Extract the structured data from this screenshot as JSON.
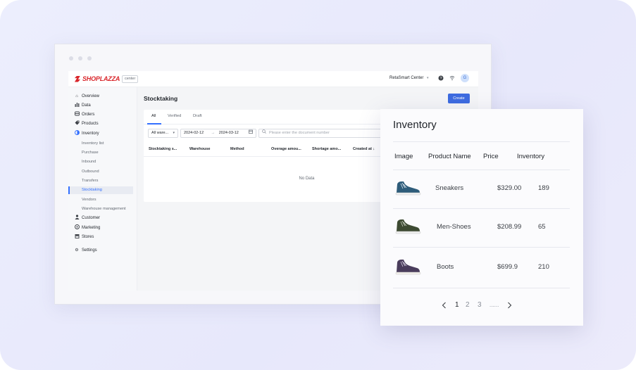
{
  "app": {
    "logo_text": "SHOPLAZZA",
    "logo_tag": "center",
    "store_selector": "RetaSmart Center",
    "avatar_initial": "G"
  },
  "sidebar": {
    "nav": [
      {
        "label": "Overview",
        "icon": "home-icon"
      },
      {
        "label": "Data",
        "icon": "bar-chart-icon"
      },
      {
        "label": "Orders",
        "icon": "orders-icon"
      },
      {
        "label": "Products",
        "icon": "tag-icon"
      },
      {
        "label": "Inventory",
        "icon": "inventory-icon"
      }
    ],
    "inventory_sub": [
      {
        "label": "Inventory list"
      },
      {
        "label": "Purchase"
      },
      {
        "label": "Inbound"
      },
      {
        "label": "Outbound"
      },
      {
        "label": "Transfers"
      },
      {
        "label": "Stocktaking",
        "active": true
      },
      {
        "label": "Vendors"
      },
      {
        "label": "Warehouse management"
      }
    ],
    "nav_after": [
      {
        "label": "Customer",
        "icon": "user-icon"
      },
      {
        "label": "Marketing",
        "icon": "marketing-icon"
      },
      {
        "label": "Stores",
        "icon": "store-icon"
      },
      {
        "label": "Settings",
        "icon": "gear-icon"
      }
    ]
  },
  "main": {
    "title": "Stocktaking",
    "create_label": "Create",
    "tabs": [
      "All",
      "Verified",
      "Draft"
    ],
    "filters": {
      "warehouse": "All ware...",
      "date_start": "2024-02-12",
      "date_sep": "→",
      "date_end": "2024-03-12",
      "search_placeholder": "Please enter the document number"
    },
    "columns": [
      "Stocktaking s...",
      "Warehouse",
      "Method",
      "Overage amou...",
      "Shortage amo...",
      "Created at ↓"
    ],
    "empty_text": "No Data"
  },
  "inventory": {
    "title": "Inventory",
    "columns": [
      "Image",
      "Product Name",
      "Price",
      "Inventory"
    ],
    "rows": [
      {
        "name": "Sneakers",
        "price": "$329.00",
        "qty": "189",
        "color": "#2e5c7a"
      },
      {
        "name": "Men-Shoes",
        "price": "$208.99",
        "qty": "65",
        "color": "#3d4a32"
      },
      {
        "name": "Boots",
        "price": "$699.9",
        "qty": "210",
        "color": "#4a3d5c"
      }
    ],
    "pagination": {
      "prev": "<",
      "pages": [
        "1",
        "2",
        "3"
      ],
      "ellipsis": "......",
      "next": ">",
      "current": "1"
    }
  }
}
